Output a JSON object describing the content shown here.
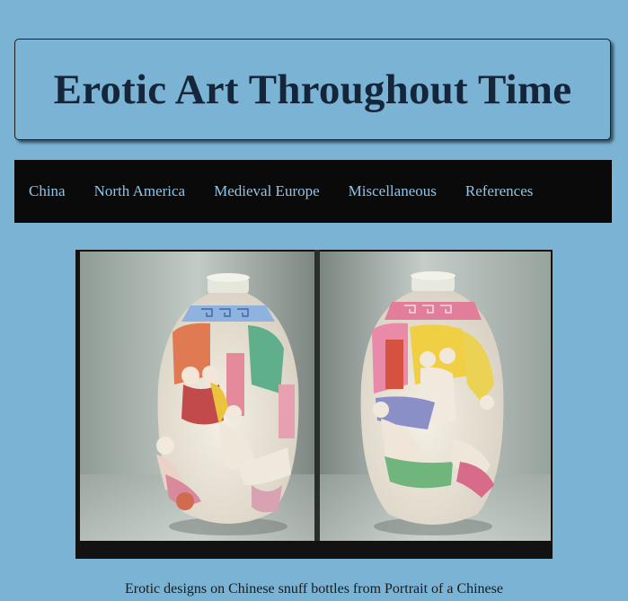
{
  "header": {
    "title": "Erotic Art Throughout Time"
  },
  "nav": {
    "items": [
      {
        "label": "China"
      },
      {
        "label": "North America"
      },
      {
        "label": "Medieval Europe"
      },
      {
        "label": "Miscellaneous"
      },
      {
        "label": "References"
      }
    ]
  },
  "figure": {
    "caption": "Erotic designs on Chinese snuff bottles from Portrait of a Chinese"
  },
  "colors": {
    "page_background": "#7ab3d4",
    "nav_background": "#0a0a0a",
    "nav_link": "#8fc5e6",
    "title_text": "#16263a"
  }
}
